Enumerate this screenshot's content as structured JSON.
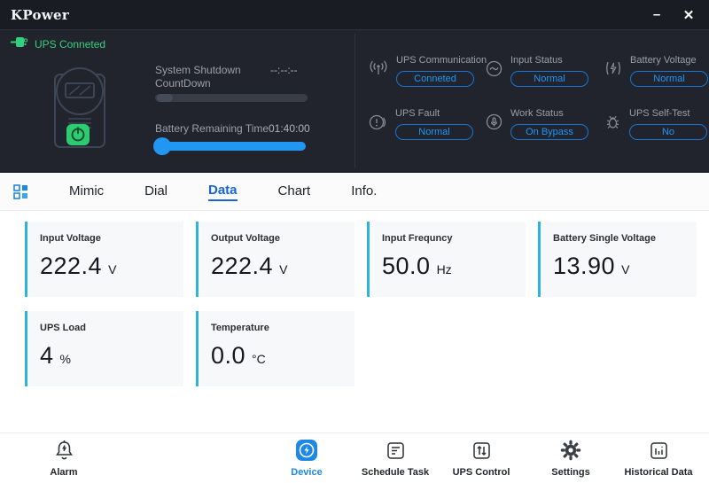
{
  "window": {
    "title": "KPower",
    "minimize_glyph": "–",
    "close_glyph": "✕"
  },
  "connection": {
    "status_text": "UPS Conneted"
  },
  "device_panel": {
    "shutdown_label": "System Shutdown CountDown",
    "shutdown_value": "--:--:--",
    "battery_label": "Battery Remaining Time",
    "battery_value": "01:40:00"
  },
  "status_grid": {
    "items": [
      {
        "icon": "antenna-icon",
        "label": "UPS Communication",
        "value": "Conneted"
      },
      {
        "icon": "sine-wave-icon",
        "label": "Input Status",
        "value": "Normal"
      },
      {
        "icon": "battery-charge-icon",
        "label": "Battery Voltage",
        "value": "Normal"
      },
      {
        "icon": "alarm-clock-icon",
        "label": "UPS Fault",
        "value": "Normal"
      },
      {
        "icon": "microphone-icon",
        "label": "Work Status",
        "value": "On Bypass"
      },
      {
        "icon": "bug-icon",
        "label": "UPS Self-Test",
        "value": "No"
      }
    ]
  },
  "tabs": {
    "items": [
      {
        "label": "Mimic",
        "active": false
      },
      {
        "label": "Dial",
        "active": false
      },
      {
        "label": "Data",
        "active": true
      },
      {
        "label": "Chart",
        "active": false
      },
      {
        "label": "Info.",
        "active": false
      }
    ]
  },
  "cards": [
    {
      "label": "Input Voltage",
      "value": "222.4",
      "unit": "V"
    },
    {
      "label": "Output Voltage",
      "value": "222.4",
      "unit": "V"
    },
    {
      "label": "Input Frequncy",
      "value": "50.0",
      "unit": "Hz"
    },
    {
      "label": "Battery Single Voltage",
      "value": "13.90",
      "unit": "V"
    },
    {
      "label": "UPS Load",
      "value": "4",
      "unit": "%"
    },
    {
      "label": "Temperature",
      "value": "0.0",
      "unit": "°C"
    }
  ],
  "bottom_nav": {
    "items": [
      {
        "icon": "alarm-bell-icon",
        "label": "Alarm",
        "active": false
      },
      {
        "icon": "device-bolt-icon",
        "label": "Device",
        "active": true
      },
      {
        "icon": "schedule-list-icon",
        "label": "Schedule Task",
        "active": false
      },
      {
        "icon": "control-sliders-icon",
        "label": "UPS Control",
        "active": false
      },
      {
        "icon": "gear-icon",
        "label": "Settings",
        "active": false
      },
      {
        "icon": "bar-chart-icon",
        "label": "Historical Data",
        "active": false
      }
    ]
  },
  "colors": {
    "accent_blue": "#2196f3",
    "active_tab_blue": "#1565d6",
    "card_border_cyan": "#2db4d8",
    "connected_green": "#35d07f",
    "panel_dark": "#21242c",
    "titlebar_dark": "#191c23"
  }
}
